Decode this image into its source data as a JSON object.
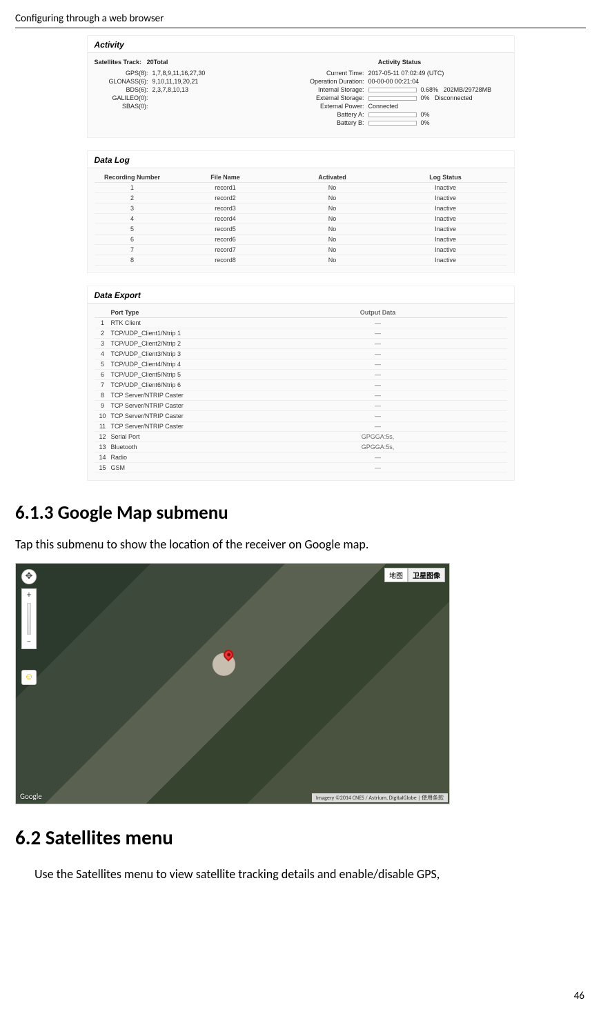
{
  "page": {
    "header": "Configuring through a web browser",
    "number": "46"
  },
  "activity": {
    "title": "Activity",
    "sat_track_label": "Satellites Track:",
    "sat_track_total": "20Total",
    "left": [
      {
        "k": "GPS(8):",
        "v": "1,7,8,9,11,16,27,30"
      },
      {
        "k": "GLONASS(6):",
        "v": "9,10,11,19,20,21"
      },
      {
        "k": "BDS(6):",
        "v": "2,3,7,8,10,13"
      },
      {
        "k": "GALILEO(0):",
        "v": ""
      },
      {
        "k": "SBAS(0):",
        "v": ""
      }
    ],
    "status_title": "Activity Status",
    "status": [
      {
        "k": "Current Time:",
        "v": "2017-05-11 07:02:49 (UTC)",
        "bar": false,
        "extra": ""
      },
      {
        "k": "Operation Duration:",
        "v": "00-00-00 00:21:04",
        "bar": false,
        "extra": ""
      },
      {
        "k": "Internal Storage:",
        "v": "0.68%",
        "bar": true,
        "extra": "202MB/29728MB"
      },
      {
        "k": "External Storage:",
        "v": "0%",
        "bar": true,
        "extra": "Disconnected"
      },
      {
        "k": "External Power:",
        "v": "Connected",
        "bar": false,
        "extra": ""
      },
      {
        "k": "Battery A:",
        "v": "0%",
        "bar": true,
        "extra": ""
      },
      {
        "k": "Battery B:",
        "v": "0%",
        "bar": true,
        "extra": ""
      }
    ]
  },
  "datalog": {
    "title": "Data Log",
    "headers": {
      "c1": "Recording Number",
      "c2": "File Name",
      "c3": "Activated",
      "c4": "Log Status"
    },
    "rows": [
      {
        "c1": "1",
        "c2": "record1",
        "c3": "No",
        "c4": "Inactive"
      },
      {
        "c1": "2",
        "c2": "record2",
        "c3": "No",
        "c4": "Inactive"
      },
      {
        "c1": "3",
        "c2": "record3",
        "c3": "No",
        "c4": "Inactive"
      },
      {
        "c1": "4",
        "c2": "record4",
        "c3": "No",
        "c4": "Inactive"
      },
      {
        "c1": "5",
        "c2": "record5",
        "c3": "No",
        "c4": "Inactive"
      },
      {
        "c1": "6",
        "c2": "record6",
        "c3": "No",
        "c4": "Inactive"
      },
      {
        "c1": "7",
        "c2": "record7",
        "c3": "No",
        "c4": "Inactive"
      },
      {
        "c1": "8",
        "c2": "record8",
        "c3": "No",
        "c4": "Inactive"
      }
    ]
  },
  "dataexport": {
    "title": "Data Export",
    "headers": {
      "c1": "Port Type",
      "c2": "Output Data"
    },
    "rows": [
      {
        "n": "1",
        "c1": "RTK Client",
        "c2": "—"
      },
      {
        "n": "2",
        "c1": "TCP/UDP_Client1/Ntrip 1",
        "c2": "—"
      },
      {
        "n": "3",
        "c1": "TCP/UDP_Client2/Ntrip 2",
        "c2": "—"
      },
      {
        "n": "4",
        "c1": "TCP/UDP_Client3/Ntrip 3",
        "c2": "—"
      },
      {
        "n": "5",
        "c1": "TCP/UDP_Client4/Ntrip 4",
        "c2": "—"
      },
      {
        "n": "6",
        "c1": "TCP/UDP_Client5/Ntrip 5",
        "c2": "—"
      },
      {
        "n": "7",
        "c1": "TCP/UDP_Client6/Ntrip 6",
        "c2": "—"
      },
      {
        "n": "8",
        "c1": "TCP Server/NTRIP Caster",
        "c2": "—"
      },
      {
        "n": "9",
        "c1": "TCP Server/NTRIP Caster",
        "c2": "—"
      },
      {
        "n": "10",
        "c1": "TCP Server/NTRIP Caster",
        "c2": "—"
      },
      {
        "n": "11",
        "c1": "TCP Server/NTRIP Caster",
        "c2": "—"
      },
      {
        "n": "12",
        "c1": "Serial Port",
        "c2": "GPGGA:5s,"
      },
      {
        "n": "13",
        "c1": "Bluetooth",
        "c2": "GPGGA:5s,"
      },
      {
        "n": "14",
        "c1": "Radio",
        "c2": "—"
      },
      {
        "n": "15",
        "c1": "GSM",
        "c2": "—"
      }
    ]
  },
  "sec613": {
    "heading": "6.1.3  Google Map submenu",
    "text": "Tap this submenu to show the location of the receiver on Google map."
  },
  "map": {
    "toggle_map": "地图",
    "toggle_sat": "卫星图像",
    "plus": "+",
    "minus": "−",
    "pan": "✥",
    "man": "☺",
    "logo": "Google",
    "attrib": "Imagery ©2014 CNES / Astrium, DigitalGlobe | 使用条款"
  },
  "sec62": {
    "heading": "6.2  Satellites menu",
    "text": "Use the Satellites menu to view satellite tracking details and enable/disable GPS,"
  }
}
